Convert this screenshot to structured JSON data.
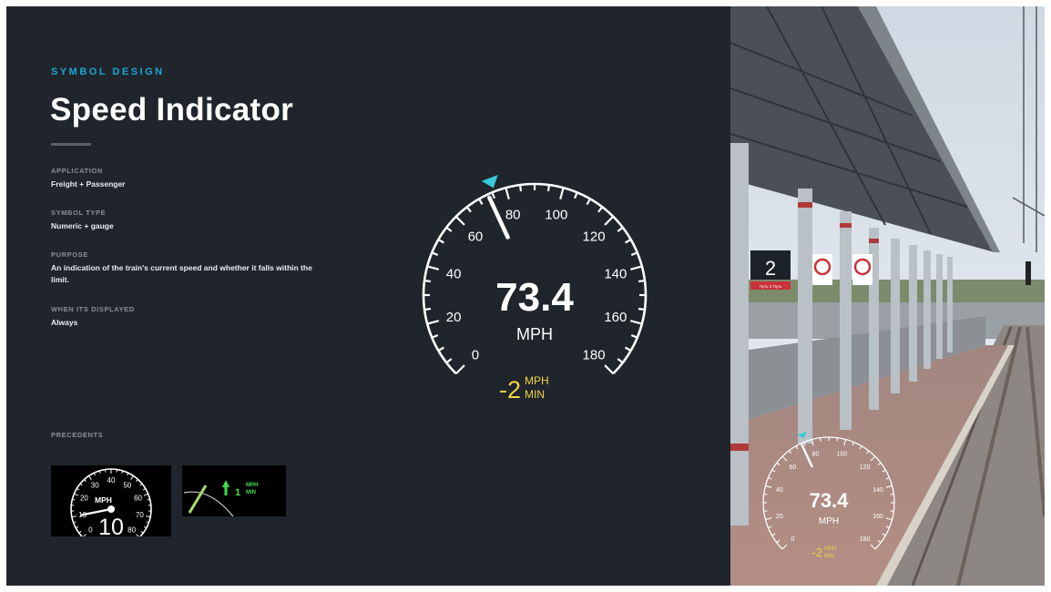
{
  "kicker": "SYMBOL DESIGN",
  "title": "Speed Indicator",
  "specs": [
    {
      "label": "APPLICATION",
      "value": "Freight + Passenger"
    },
    {
      "label": "SYMBOL TYPE",
      "value": "Numeric + gauge"
    },
    {
      "label": "PURPOSE",
      "value": "An indication of the train's current speed and whether it falls within the limit."
    },
    {
      "label": "WHEN ITS DISPLAYED",
      "value": "Always"
    }
  ],
  "precedents_label": "PRECEDENTS",
  "gauge": {
    "speed": "73.4",
    "unit": "MPH",
    "speed_value": 73.4,
    "limit_marker_value": 76,
    "max": 180,
    "ticks": [
      "0",
      "20",
      "40",
      "60",
      "80",
      "100",
      "120",
      "140",
      "160",
      "180"
    ],
    "rate_value": "-2",
    "rate_unit_top": "MPH",
    "rate_unit_bottom": "MIN",
    "colors": {
      "needle": "#ffffff",
      "marker": "#36c9d8",
      "rate": "#f1d443",
      "dial": "#ffffff"
    }
  },
  "precedent_1": {
    "ticks": [
      "0",
      "10",
      "20",
      "30",
      "40",
      "50",
      "60",
      "70",
      "80"
    ],
    "unit": "MPH",
    "value": "10"
  },
  "precedent_2": {
    "value": "1",
    "unit_top": "MPH",
    "unit_bottom": "MIN",
    "color": "#3fdc4c"
  },
  "photo": {
    "platform_number": "2",
    "sign_text": "Путь 2 Путь"
  }
}
